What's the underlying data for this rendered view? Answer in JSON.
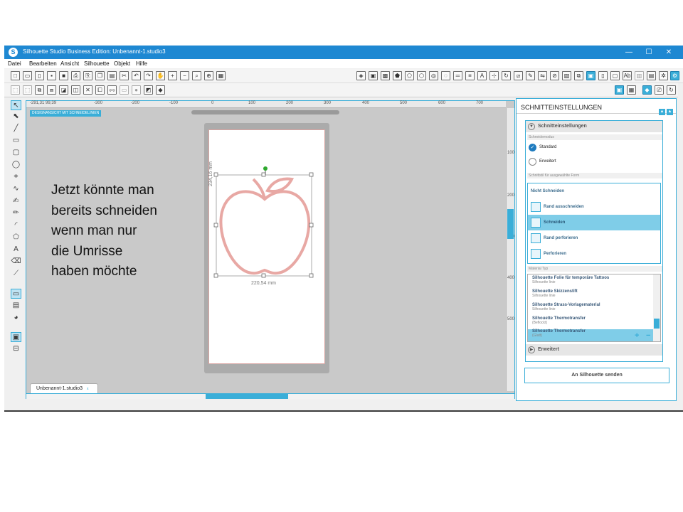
{
  "window": {
    "title": "Silhouette Studio Business Edition: Unbenannt-1.studio3",
    "app_icon": "S",
    "minimize": "—",
    "maximize": "☐",
    "close": "✕"
  },
  "menu": {
    "items": [
      "Datei",
      "Bearbeiten",
      "Ansicht",
      "Silhouette",
      "Objekt",
      "Hilfe"
    ]
  },
  "ruler": {
    "h_labels": [
      "-300",
      "-200",
      "-100",
      "0",
      "100",
      "200",
      "300",
      "400",
      "500",
      "600",
      "700"
    ],
    "corner": "-291,31  99,39",
    "v_labels": [
      "100",
      "200",
      "300",
      "400",
      "500"
    ]
  },
  "workspace": {
    "design_label": "DESIGNANSICHT MIT SCHNEIDELINIEN",
    "height_dim": "234,16 mm",
    "width_dim": "220,54 mm",
    "doc_tab": "Unbenannt-1.studio3",
    "doc_tab_close": "x"
  },
  "overlay": {
    "lines": [
      "Jetzt könnte man",
      "bereits schneiden",
      "wenn man nur",
      "die Umrisse",
      "haben möchte"
    ]
  },
  "panel": {
    "title": "SCHNITTEINSTELLUNGEN",
    "section_title": "Schnitteinstellungen",
    "mode_label": "Schneidemodus",
    "mode_standard": "Standard",
    "mode_extended": "Erweitert",
    "cut_style_label": "Schnittstil für ausgewählte Form",
    "cut_none": "Nicht Schneiden",
    "cut_edge": "Rand ausschneiden",
    "cut": "Schneiden",
    "perf_edge": "Rand perforieren",
    "perf": "Perforieren",
    "material_label": "Material Typ",
    "materials": [
      {
        "name": "Silhouette Folie für temporäre Tattoos",
        "sub": "Silhouette linie"
      },
      {
        "name": "Silhouette Skizzenstift",
        "sub": "Silhouette linie"
      },
      {
        "name": "Silhouette Strass-Vorlagematerial",
        "sub": "Silhouette linie"
      },
      {
        "name": "Silhouette Thermotransfer",
        "sub": "(Beflockt)"
      },
      {
        "name": "Silhouette Thermotransfer",
        "sub": "(Glatt)"
      }
    ],
    "add": "+",
    "remove": "−",
    "advanced": "Erweitert",
    "send_button": "An Silhouette senden"
  },
  "colors": {
    "accent": "#3aaed8",
    "titlebar": "#1e88d2",
    "apple_outline": "#e8a8a4"
  }
}
